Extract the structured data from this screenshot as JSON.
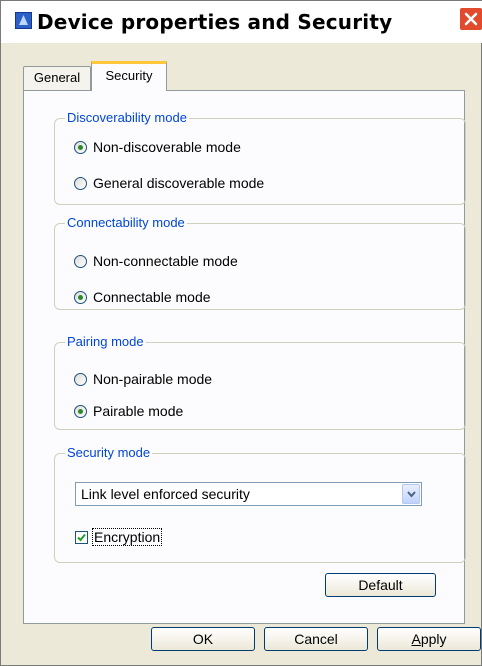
{
  "window": {
    "title": "Device properties and Security",
    "close_icon": "close-icon"
  },
  "tabs": [
    {
      "label": "General",
      "selected": false
    },
    {
      "label": "Security",
      "selected": true
    }
  ],
  "groups": {
    "discoverability": {
      "title": "Discoverability mode",
      "options": [
        {
          "label": "Non-discoverable mode",
          "selected": true
        },
        {
          "label": "General discoverable mode",
          "selected": false
        }
      ]
    },
    "connectability": {
      "title": "Connectability mode",
      "options": [
        {
          "label": "Non-connectable mode",
          "selected": false
        },
        {
          "label": "Connectable mode",
          "selected": true
        }
      ]
    },
    "pairing": {
      "title": "Pairing mode",
      "options": [
        {
          "label": "Non-pairable mode",
          "selected": false
        },
        {
          "label": "Pairable mode",
          "selected": true
        }
      ]
    },
    "security": {
      "title": "Security mode",
      "select_value": "Link level enforced security",
      "encryption_label": "Encryption",
      "encryption_checked": true
    }
  },
  "buttons": {
    "default": "Default",
    "ok": "OK",
    "cancel": "Cancel",
    "apply_first": "A",
    "apply_rest": "pply"
  },
  "colors": {
    "group_title": "#0046d5",
    "tab_highlight": "#ffc83c",
    "close": "#e24a2d"
  }
}
